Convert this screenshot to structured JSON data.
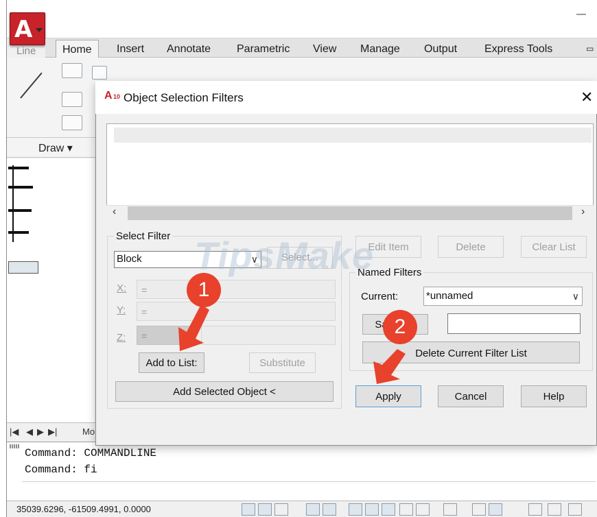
{
  "app": {
    "ribbon_tabs": [
      "Home",
      "Insert",
      "Annotate",
      "Parametric",
      "View",
      "Manage",
      "Output",
      "Express Tools"
    ],
    "draw_panel_label": "Draw",
    "line_tool_label": "Line",
    "layout_tab_label": "Mo",
    "command_history": [
      "Command:  COMMANDLINE",
      "Command:  fi"
    ],
    "coordinates": "35039.6296, -61509.4991, 0.0000",
    "logo_letter": "A"
  },
  "dialog": {
    "icon_text": "A",
    "icon_version": "10",
    "title": "Object Selection Filters",
    "close_glyph": "✕",
    "select_filter": {
      "group_label": "Select Filter",
      "type_value": "Block",
      "select_button": "Select...",
      "x_label": "X:",
      "y_label": "Y:",
      "z_label": "Z:",
      "operator": "=",
      "add_to_list_button": "Add to List:",
      "substitute_button": "Substitute",
      "add_selected_object_button": "Add Selected Object <"
    },
    "list_buttons": {
      "edit_item": "Edit Item",
      "delete": "Delete",
      "clear_list": "Clear List"
    },
    "named_filters": {
      "group_label": "Named Filters",
      "current_label": "Current:",
      "current_value": "*unnamed",
      "save_as_button": "Save As:",
      "save_as_value": "",
      "delete_current_button": "Delete Current Filter List"
    },
    "footer": {
      "apply": "Apply",
      "cancel": "Cancel",
      "help": "Help"
    }
  },
  "annotations": {
    "step1": "1",
    "step2": "2",
    "watermark": "TipsMake",
    "arrow_color": "#e8412c"
  }
}
